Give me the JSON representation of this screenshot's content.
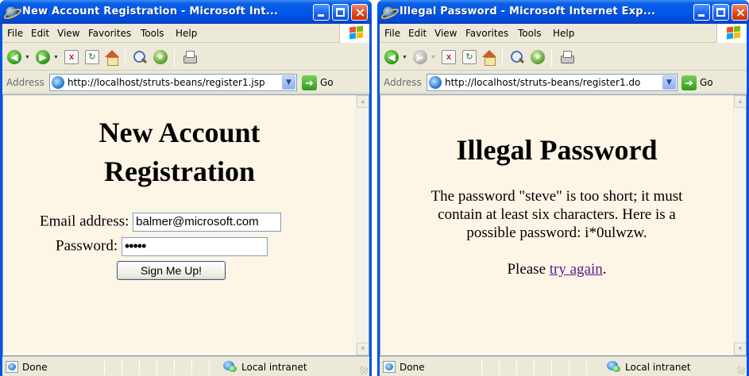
{
  "colors": {
    "title_bar": "#0058ee",
    "page_background": "#fdf5e6",
    "visited_link": "#551a8b",
    "chrome": "#ece9d8"
  },
  "menu": [
    "File",
    "Edit",
    "View",
    "Favorites",
    "Tools",
    "Help"
  ],
  "left": {
    "title": "New Account Registration - Microsoft Int...",
    "address_label": "Address",
    "url": "http://localhost/struts-beans/register1.jsp",
    "go_label": "Go",
    "heading_line1": "New Account",
    "heading_line2": "Registration",
    "email_label": "Email address:",
    "email_value": "balmer@microsoft.com",
    "password_label": "Password:",
    "password_value": "•••••",
    "submit_label": "Sign Me Up!",
    "status_text": "Done",
    "zone_text": "Local intranet"
  },
  "right": {
    "title": "Illegal Password - Microsoft Internet Exp...",
    "address_label": "Address",
    "url": "http://localhost/struts-beans/register1.do",
    "go_label": "Go",
    "heading": "Illegal Password",
    "msg_line1": "The password \"steve\" is too short; it must",
    "msg_line2": "contain at least six characters. Here is a",
    "msg_line3": "possible password: i*0ulwzw.",
    "please_text": "Please",
    "link_text": "try again",
    "period": ".",
    "status_text": "Done",
    "zone_text": "Local intranet"
  }
}
